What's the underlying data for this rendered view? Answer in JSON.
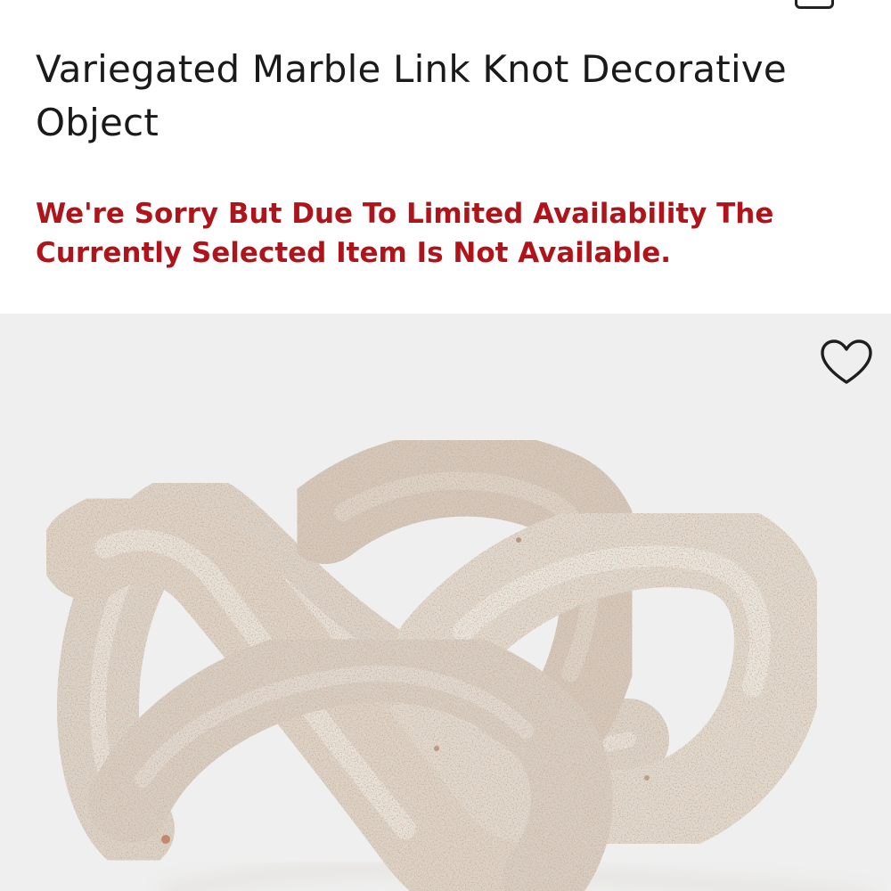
{
  "product": {
    "title": "Variegated Marble Link Knot Decorative Object",
    "availability_message": "We're Sorry But Due To Limited Availability The Currently Selected Item Is Not Available."
  },
  "icons": {
    "top_right": "bag-icon",
    "favorite": "heart-outline-icon"
  },
  "colors": {
    "availability_text": "#b0141b",
    "image_background": "#efefef",
    "marble_base": "#e6ded3",
    "marble_speckle": "#b99d8b"
  }
}
